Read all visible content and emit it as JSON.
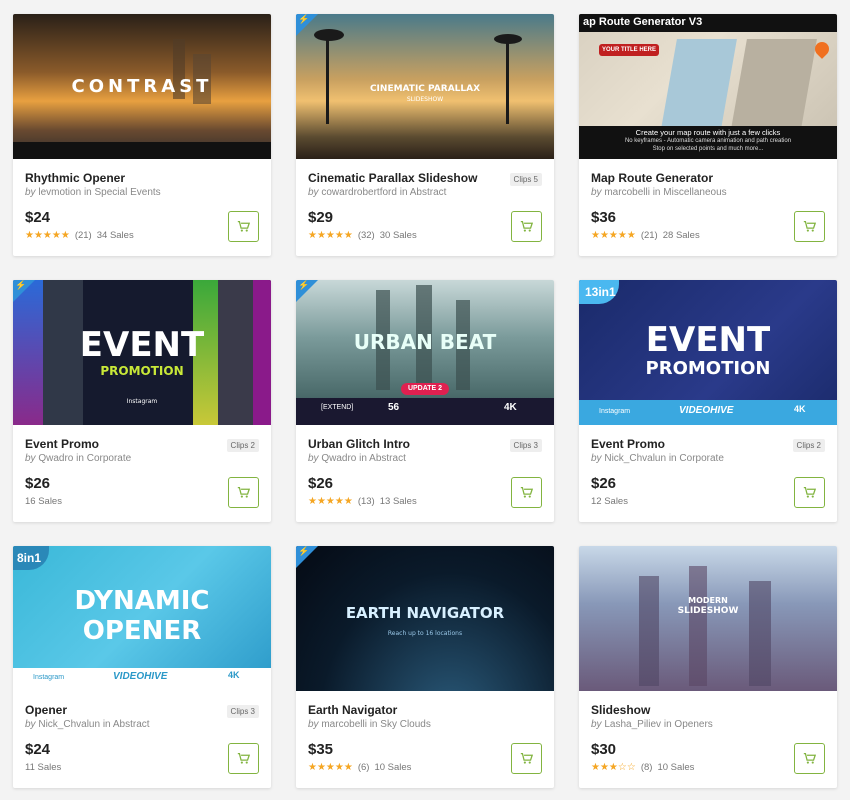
{
  "colors": {
    "accent": "#82b440",
    "star": "#f5a623",
    "badge": "#2f8fd8"
  },
  "cards": [
    {
      "title": "Rhythmic Opener",
      "by": "by",
      "author": "levmotion",
      "in": "in",
      "category": "Special Events",
      "clips": "",
      "price": "$24",
      "stars": "★★★★★",
      "rating_count": "(21)",
      "sales": "34 Sales",
      "thumb_text": "CONTRAST",
      "thumb_sub": "",
      "flash": false
    },
    {
      "title": "Cinematic Parallax Slideshow",
      "by": "by",
      "author": "cowardrobertford",
      "in": "in",
      "category": "Abstract",
      "clips": "Clips 5",
      "price": "$29",
      "stars": "★★★★★",
      "rating_count": "(32)",
      "sales": "30 Sales",
      "thumb_text": "CINEMATIC PARALLAX",
      "thumb_sub": "SLIDESHOW",
      "flash": true
    },
    {
      "title": "Map Route Generator",
      "by": "by",
      "author": "marcobelli",
      "in": "in",
      "category": "Miscellaneous",
      "clips": "",
      "price": "$36",
      "stars": "★★★★★",
      "rating_count": "(21)",
      "sales": "28 Sales",
      "thumb_text": "ap Route Generator V3",
      "thumb_sub": "Create your map route with just a few clicks",
      "flash": false
    },
    {
      "title": "Event Promo",
      "by": "by",
      "author": "Qwadro",
      "in": "in",
      "category": "Corporate",
      "clips": "Clips 2",
      "price": "$26",
      "stars": "",
      "rating_count": "",
      "sales": "16 Sales",
      "thumb_text": "EVENT",
      "thumb_sub": "PROMOTION",
      "flash": true
    },
    {
      "title": "Urban Glitch Intro",
      "by": "by",
      "author": "Qwadro",
      "in": "in",
      "category": "Abstract",
      "clips": "Clips 3",
      "price": "$26",
      "stars": "★★★★★",
      "rating_count": "(13)",
      "sales": "13 Sales",
      "thumb_text": "URBAN BEAT",
      "thumb_sub": "UPDATE 2",
      "flash": true
    },
    {
      "title": "Event Promo",
      "by": "by",
      "author": "Nick_Chvalun",
      "in": "in",
      "category": "Corporate",
      "clips": "Clips 2",
      "price": "$26",
      "stars": "",
      "rating_count": "",
      "sales": "12 Sales",
      "thumb_text": "EVENT",
      "thumb_sub": "PROMOTION",
      "flash": false,
      "corner": "13in1"
    },
    {
      "title": "Opener",
      "by": "by",
      "author": "Nick_Chvalun",
      "in": "in",
      "category": "Abstract",
      "clips": "Clips 3",
      "price": "$24",
      "stars": "",
      "rating_count": "",
      "sales": "11 Sales",
      "thumb_text": "DYNAMIC",
      "thumb_sub": "OPENER",
      "flash": false,
      "corner": "8in1"
    },
    {
      "title": "Earth Navigator",
      "by": "by",
      "author": "marcobelli",
      "in": "in",
      "category": "Sky Clouds",
      "clips": "",
      "price": "$35",
      "stars": "★★★★★",
      "rating_count": "(6)",
      "sales": "10 Sales",
      "thumb_text": "EARTH NAVIGATOR",
      "thumb_sub": "",
      "flash": true
    },
    {
      "title": "Slideshow",
      "by": "by",
      "author": "Lasha_Piliev",
      "in": "in",
      "category": "Openers",
      "clips": "",
      "price": "$30",
      "stars": "★★★☆☆",
      "rating_count": "(8)",
      "sales": "10 Sales",
      "thumb_text": "MODERN",
      "thumb_sub": "SLIDESHOW",
      "flash": false
    }
  ],
  "thumb_extras": {
    "videohive": "VIDEOHIVE",
    "instagram": "Instagram",
    "res_4k": "4K",
    "map_bullets": "No keyframes - Automatic camera animation and path creation",
    "map_bullets2": "Stop on selected points and much more...",
    "your_title": "YOUR TITLE HERE",
    "extend": "[EXTEND]",
    "fifty_six": "56",
    "earth_sub": "Reach up to 16 locations"
  }
}
